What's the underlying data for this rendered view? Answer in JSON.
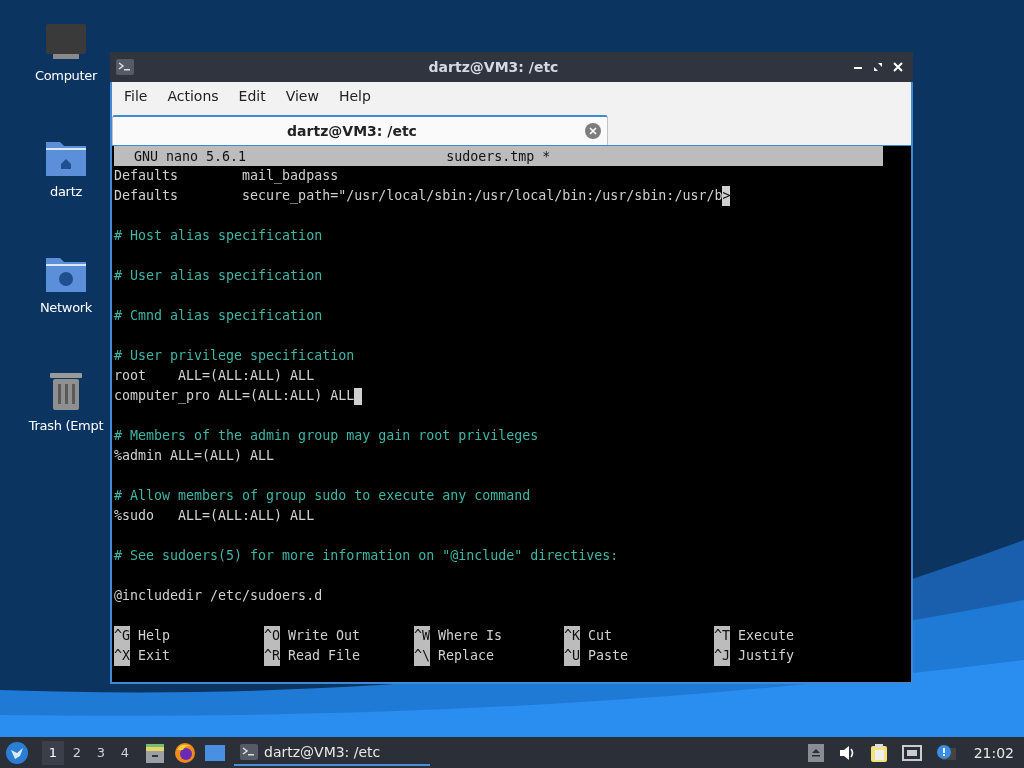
{
  "desktop_icons": [
    {
      "kind": "computer",
      "label": "Computer"
    },
    {
      "kind": "home",
      "label": "dartz"
    },
    {
      "kind": "network",
      "label": "Network"
    },
    {
      "kind": "trash",
      "label": "Trash (Empt"
    }
  ],
  "window": {
    "title": "dartz@VM3: /etc",
    "menu": [
      "File",
      "Actions",
      "Edit",
      "View",
      "Help"
    ],
    "tabs": [
      {
        "label": "dartz@VM3: /etc",
        "selected": true
      }
    ],
    "nano": {
      "version": "GNU nano 5.6.1",
      "filename": "sudoers.tmp *",
      "lines": [
        {
          "kind": "code",
          "text": "Defaults        mail_badpass"
        },
        {
          "kind": "code",
          "text": "Defaults        secure_path=\"/usr/local/sbin:/usr/local/bin:/usr/sbin:/usr/b",
          "marker": ">"
        },
        {
          "kind": "blank"
        },
        {
          "kind": "comment",
          "text": "# Host alias specification"
        },
        {
          "kind": "blank"
        },
        {
          "kind": "comment",
          "text": "# User alias specification"
        },
        {
          "kind": "blank"
        },
        {
          "kind": "comment",
          "text": "# Cmnd alias specification"
        },
        {
          "kind": "blank"
        },
        {
          "kind": "comment",
          "text": "# User privilege specification"
        },
        {
          "kind": "code",
          "text": "root    ALL=(ALL:ALL) ALL"
        },
        {
          "kind": "code",
          "text": "computer_pro ALL=(ALL:ALL) ALL",
          "cursor": true
        },
        {
          "kind": "blank"
        },
        {
          "kind": "comment",
          "text": "# Members of the admin group may gain root privileges"
        },
        {
          "kind": "code",
          "text": "%admin ALL=(ALL) ALL"
        },
        {
          "kind": "blank"
        },
        {
          "kind": "comment",
          "text": "# Allow members of group sudo to execute any command"
        },
        {
          "kind": "code",
          "text": "%sudo   ALL=(ALL:ALL) ALL"
        },
        {
          "kind": "blank"
        },
        {
          "kind": "comment",
          "text": "# See sudoers(5) for more information on \"@include\" directives:"
        },
        {
          "kind": "blank"
        },
        {
          "kind": "code",
          "text": "@includedir /etc/sudoers.d"
        },
        {
          "kind": "blank"
        }
      ],
      "shortcuts": [
        [
          {
            "key": "^G",
            "label": "Help"
          },
          {
            "key": "^O",
            "label": "Write Out"
          },
          {
            "key": "^W",
            "label": "Where Is"
          },
          {
            "key": "^K",
            "label": "Cut"
          },
          {
            "key": "^T",
            "label": "Execute"
          }
        ],
        [
          {
            "key": "^X",
            "label": "Exit"
          },
          {
            "key": "^R",
            "label": "Read File"
          },
          {
            "key": "^\\",
            "label": "Replace"
          },
          {
            "key": "^U",
            "label": "Paste"
          },
          {
            "key": "^J",
            "label": "Justify"
          }
        ]
      ]
    }
  },
  "taskbar": {
    "workspaces": [
      {
        "label": "1",
        "selected": true
      },
      {
        "label": "2",
        "selected": false
      },
      {
        "label": "3",
        "selected": false
      },
      {
        "label": "4",
        "selected": false
      }
    ],
    "launchers": [
      {
        "kind": "files"
      },
      {
        "kind": "browser"
      },
      {
        "kind": "desktop"
      }
    ],
    "tasks": [
      {
        "label": "dartz@VM3: /etc",
        "selected": true
      }
    ],
    "clock": "21:02"
  }
}
